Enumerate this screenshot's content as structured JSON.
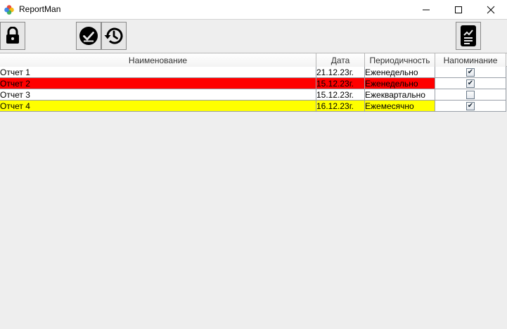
{
  "window": {
    "title": "ReportMan",
    "controls": [
      "minimize-icon",
      "maximize-icon",
      "close-icon"
    ]
  },
  "toolbar": {
    "buttons": [
      {
        "name": "lock-button",
        "icon": "lock-icon"
      },
      {
        "name": "mark-done-button",
        "icon": "check-circle-icon"
      },
      {
        "name": "history-button",
        "icon": "history-icon"
      },
      {
        "name": "report-button",
        "icon": "report-document-icon"
      }
    ]
  },
  "table": {
    "columns": [
      "Наименование",
      "Дата",
      "Периодичность",
      "Напоминание"
    ],
    "rows": [
      {
        "name": "Отчет 1",
        "date": "21.12.23г.",
        "period": "Еженедельно",
        "reminder": true,
        "bg": "#ffffff"
      },
      {
        "name": "Отчет 2",
        "date": "15.12.23г.",
        "period": "Еженедельно",
        "reminder": true,
        "bg": "#ff0000"
      },
      {
        "name": "Отчет 3",
        "date": "15.12.23г.",
        "period": "Ежеквартально",
        "reminder": false,
        "bg": "#ffffff"
      },
      {
        "name": "Отчет 4",
        "date": "16.12.23г.",
        "period": "Ежемесячно",
        "reminder": true,
        "bg": "#ffff00"
      }
    ]
  },
  "colors": {
    "overdue": "#ff0000",
    "upcoming": "#ffff00",
    "normal": "#ffffff"
  }
}
